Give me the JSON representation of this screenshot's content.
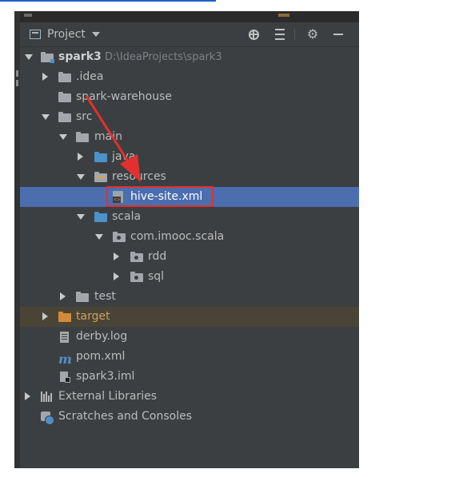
{
  "panel": {
    "view_label": "Project",
    "toolbar_icons": [
      "locate-icon",
      "collapse-all-icon",
      "gear-icon",
      "hide-icon"
    ]
  },
  "tree": {
    "root": {
      "name": "spark3",
      "path": "D:\\IdeaProjects\\spark3"
    },
    "idea": "idea",
    "idea_dot": ".",
    "spark_warehouse": "spark-warehouse",
    "src": "src",
    "main": "main",
    "java": "java",
    "resources": "resources",
    "hive_site": "hive-site.xml",
    "scala": "scala",
    "package": "com.imooc.scala",
    "rdd": "rdd",
    "sql": "sql",
    "test": "test",
    "target": "target",
    "derby_log": "derby.log",
    "pom": "pom.xml",
    "iml": "spark3.iml",
    "external_libraries": "External Libraries",
    "scratches": "Scratches and Consoles"
  },
  "annotation": {
    "color": "#e23030",
    "highlighted_item": "hive-site.xml"
  },
  "colors": {
    "panel_bg": "#3c3f41",
    "selection": "#4b6eaf",
    "excluded_row": "#4a4436",
    "source_folder": "#4d91c9",
    "excluded_folder": "#d2893a"
  }
}
